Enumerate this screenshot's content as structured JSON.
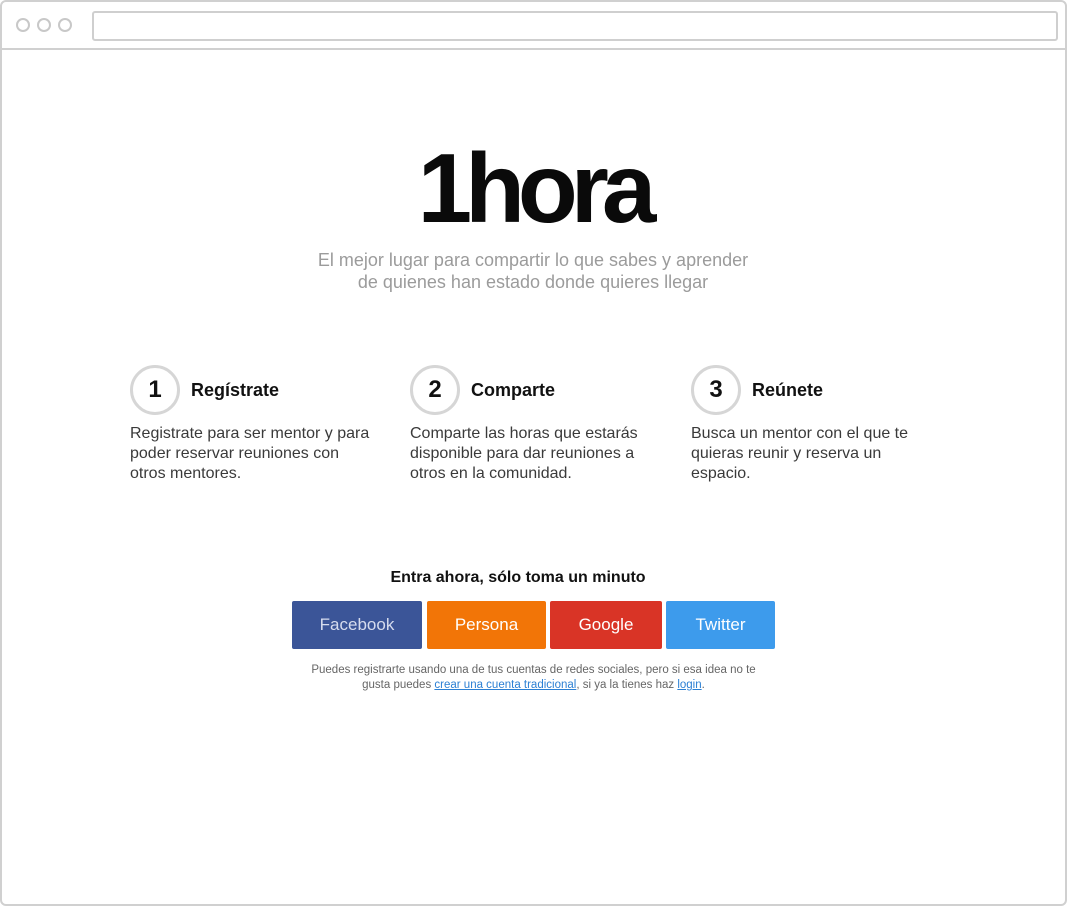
{
  "brand": {
    "logo_text": "1hora"
  },
  "hero": {
    "tagline_line1": "El mejor lugar para compartir lo que sabes y aprender",
    "tagline_line2": "de quienes han estado donde quieres llegar"
  },
  "steps": [
    {
      "number": "1",
      "title": "Regístrate",
      "description": "Registrate para ser mentor y para poder reservar reuniones con otros mentores."
    },
    {
      "number": "2",
      "title": "Comparte",
      "description": "Comparte las horas que estarás disponible para dar reuniones a otros en la comunidad."
    },
    {
      "number": "3",
      "title": "Reúnete",
      "description": "Busca un mentor con el que te quieras reunir y reserva un espacio."
    }
  ],
  "signup": {
    "title": "Entra ahora, sólo toma un minuto",
    "buttons": [
      {
        "label": "Facebook",
        "color": "#3b5598"
      },
      {
        "label": "Persona",
        "color": "#f27507"
      },
      {
        "label": "Google",
        "color": "#d93426"
      },
      {
        "label": "Twitter",
        "color": "#3d9bec"
      }
    ],
    "note_part1": "Puedes registrarte usando una de tus cuentas de redes sociales, pero si esa idea no te gusta puedes ",
    "note_link1": "crear una cuenta tradicional",
    "note_part2": ", si ya la tienes haz ",
    "note_link2": "login",
    "note_part3": "."
  },
  "colors": {
    "link": "#2b7fd3",
    "frame_border": "#d0d0d0",
    "tagline": "#9b9b9b"
  }
}
